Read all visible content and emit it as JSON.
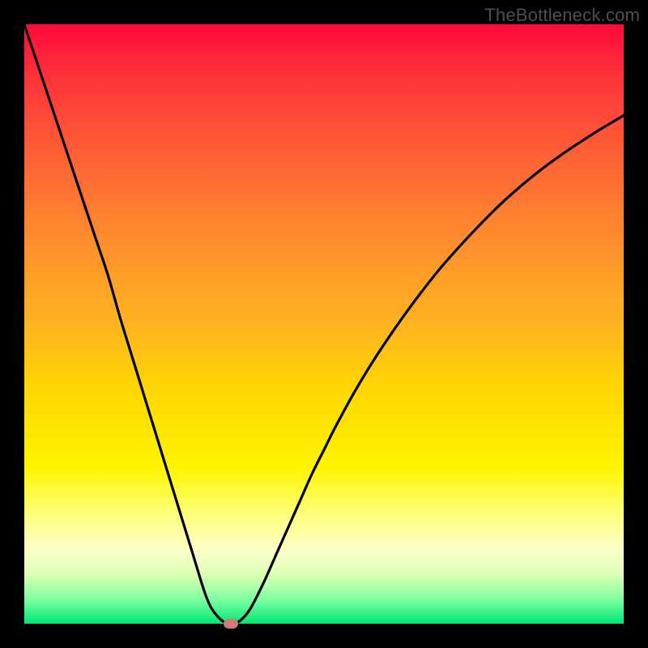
{
  "watermark": "TheBottleneck.com",
  "chart_data": {
    "type": "line",
    "title": "",
    "xlabel": "",
    "ylabel": "",
    "xlim": [
      0,
      100
    ],
    "ylim": [
      0,
      100
    ],
    "x": [
      0,
      2,
      4,
      6,
      8,
      10,
      12,
      14,
      16,
      18,
      20,
      22,
      24,
      26,
      28,
      30,
      31,
      32,
      33,
      34,
      35,
      36,
      37,
      38,
      40,
      42,
      44,
      46,
      48,
      50,
      52,
      55,
      58,
      62,
      66,
      70,
      75,
      80,
      85,
      90,
      95,
      100
    ],
    "values": [
      100,
      94,
      88,
      82,
      76,
      70,
      64,
      58,
      51,
      44.5,
      38,
      31.5,
      25,
      18.5,
      12,
      5.5,
      3,
      1.5,
      0.5,
      0,
      0,
      0.5,
      1.5,
      3,
      7,
      11.5,
      16,
      20.5,
      25,
      29,
      33,
      38.5,
      43.5,
      49.5,
      55,
      60,
      65.5,
      70.5,
      74.8,
      78.5,
      81.8,
      84.8
    ],
    "marker": {
      "x": 34.5,
      "y": 0
    },
    "background_gradient": {
      "top": "#ff0a3a",
      "mid": "#ffee00",
      "bottom": "#00e676"
    }
  }
}
